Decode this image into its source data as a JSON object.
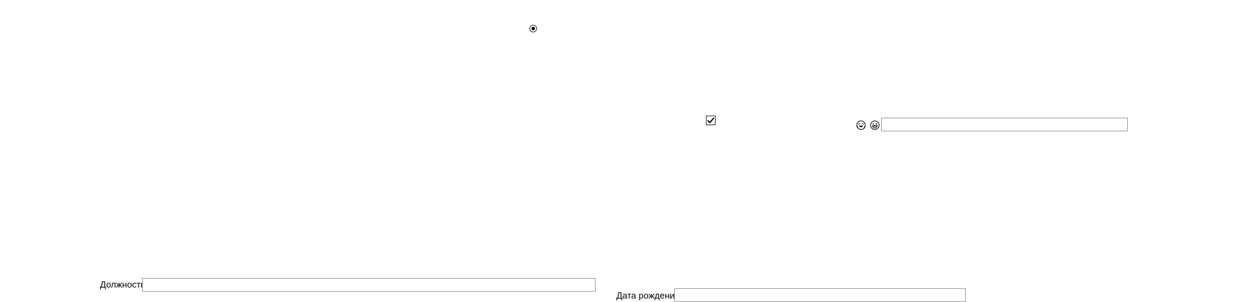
{
  "radio": {
    "checked": true
  },
  "checkbox": {
    "checked": true
  },
  "icons": [
    "laughing-emoji-icon",
    "grinning-emoji-icon"
  ],
  "top_field": {
    "value": ""
  },
  "position_field": {
    "label": "Должность",
    "value": ""
  },
  "birthdate_field": {
    "label": "Дата рождения",
    "value": ""
  }
}
